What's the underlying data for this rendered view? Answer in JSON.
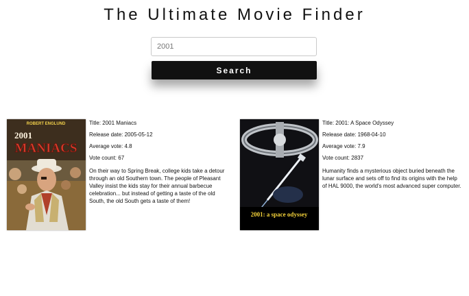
{
  "header": {
    "title": "The Ultimate Movie Finder"
  },
  "search": {
    "value": "2001",
    "button_label": "Search"
  },
  "movies": [
    {
      "poster_text_top": "ROBERT ENGLUND",
      "poster_title_number": "2001",
      "poster_title_word": "MANIACS",
      "title": "Title: 2001 Maniacs",
      "release_date": "Release date: 2005-05-12",
      "average_vote": "Average vote: 4.8",
      "vote_count": "Vote count: 67",
      "overview": "On their way to Spring Break, college kids take a detour through an old Southern town. The people of Pleasant Valley insist the kids stay for their annual barbecue celebration... but instead of getting a taste of the old South, the old South gets a taste of them!"
    },
    {
      "poster_caption": "2001: a space odyssey",
      "title": "Title: 2001: A Space Odyssey",
      "release_date": "Release date: 1968-04-10",
      "average_vote": "Average vote: 7.9",
      "vote_count": "Vote count: 2837",
      "overview": "Humanity finds a mysterious object buried beneath the lunar surface and sets off to find its origins with the help of HAL 9000, the world's most advanced super computer."
    }
  ]
}
